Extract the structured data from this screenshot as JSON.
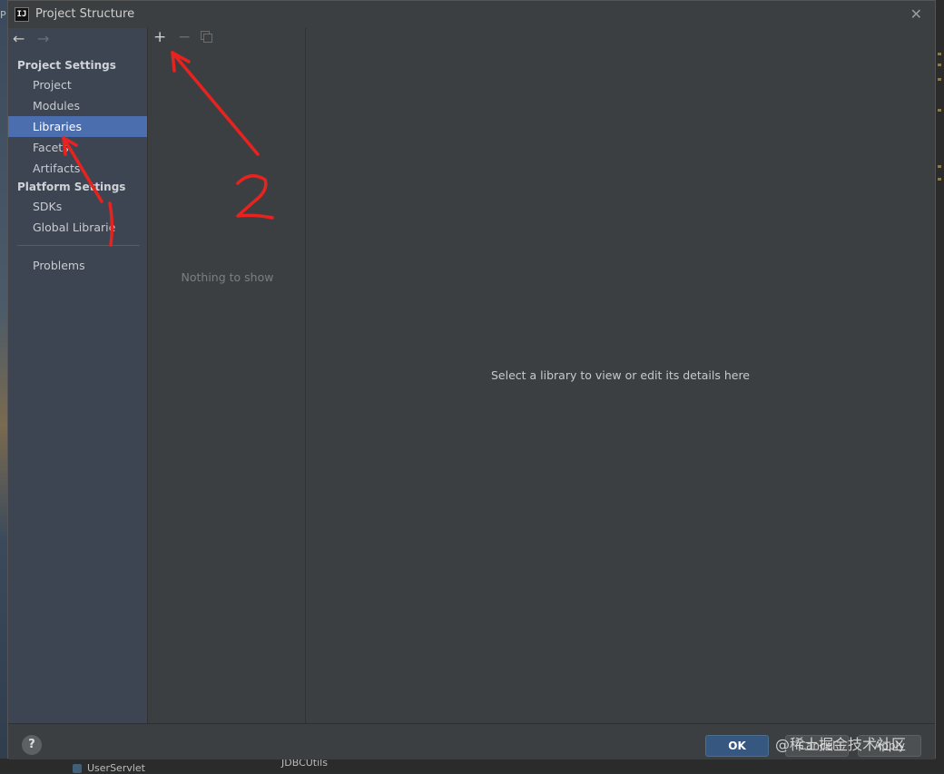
{
  "window": {
    "title": "Project Structure",
    "app_icon": "intellij-icon",
    "app_icon_text": "IJ"
  },
  "background": {
    "left_label": "P",
    "bottom_items": [
      "UserServlet",
      "JDBCUtils"
    ]
  },
  "sidebar": {
    "sections": [
      {
        "title": "Project Settings",
        "items": [
          "Project",
          "Modules",
          "Libraries",
          "Facets",
          "Artifacts"
        ]
      },
      {
        "title": "Platform Settings",
        "items": [
          "SDKs",
          "Global Librarie"
        ]
      }
    ],
    "extra_items": [
      "Problems"
    ],
    "selected": "Libraries"
  },
  "toolbar": {
    "add": "+",
    "remove": "−"
  },
  "middle": {
    "empty_text": "Nothing to show"
  },
  "details": {
    "placeholder": "Select a library to view or edit its details here"
  },
  "footer": {
    "help": "?",
    "ok": "OK",
    "cancel": "Cancel",
    "apply": "Apply"
  },
  "watermark": "@稀土掘金技术社区",
  "annotations": {
    "labels": [
      "1",
      "2"
    ],
    "color": "#e8231f"
  },
  "colors": {
    "selection": "#4b6eaf",
    "sidebar_bg": "#3d4552",
    "dialog_bg": "#3c3f41",
    "ok_button": "#365880"
  }
}
